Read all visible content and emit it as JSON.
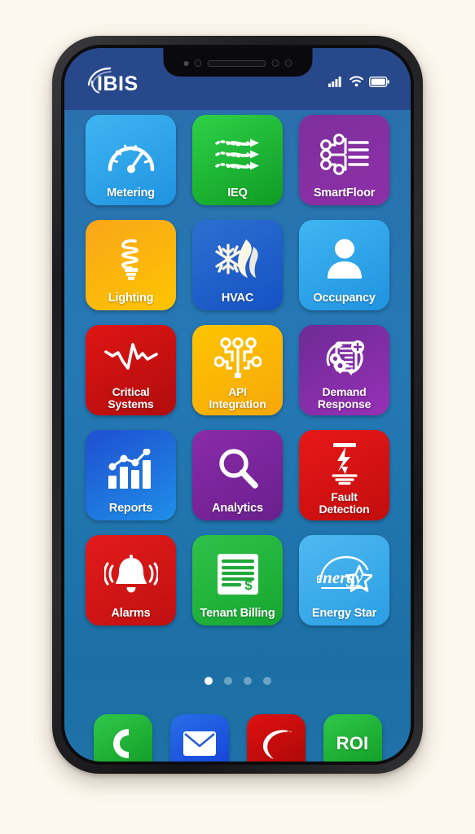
{
  "device": {
    "frame_color": "#1d1d1f",
    "screen_bg_top": "#28488c",
    "screen_bg_main": "#2578b4",
    "page_bg": "#fdf8ef"
  },
  "status_bar": {
    "brand": "IBIS",
    "icons": [
      "signal-bars-icon",
      "wifi-icon",
      "battery-icon"
    ]
  },
  "apps": [
    {
      "id": "metering",
      "label": "Metering",
      "icon": "gauge-icon",
      "color_start": "#3fb5f2",
      "color_end": "#1f93e0"
    },
    {
      "id": "ieq",
      "label": "IEQ",
      "icon": "airflow-icon",
      "color_start": "#2fd14a",
      "color_end": "#0f9c22"
    },
    {
      "id": "smartfloor",
      "label": "SmartFloor",
      "icon": "circuit-floor-icon",
      "color_start": "#7e2f9e",
      "color_end": "#8e2fa8"
    },
    {
      "id": "lighting",
      "label": "Lighting",
      "icon": "cfl-bulb-icon",
      "color_start": "#f9a51a",
      "color_end": "#fdc500"
    },
    {
      "id": "hvac",
      "label": "HVAC",
      "icon": "snowflake-flame-icon",
      "color_start": "#2d6fd0",
      "color_end": "#1552c4"
    },
    {
      "id": "occupancy",
      "label": "Occupancy",
      "icon": "person-icon",
      "color_start": "#3fb5f2",
      "color_end": "#1f93e0"
    },
    {
      "id": "critical-systems",
      "label": "Critical\nSystems",
      "icon": "trend-line-icon",
      "color_start": "#e01414",
      "color_end": "#b00d0d"
    },
    {
      "id": "api-integration",
      "label": "API\nIntegration",
      "icon": "api-nodes-icon",
      "color_start": "#fdc500",
      "color_end": "#f7a70a"
    },
    {
      "id": "demand-response",
      "label": "Demand\nResponse",
      "icon": "doc-gears-cycle-icon",
      "color_start": "#6d2b96",
      "color_end": "#9730b5"
    },
    {
      "id": "reports",
      "label": "Reports",
      "icon": "bar-chart-icon",
      "color_start": "#1f4fd0",
      "color_end": "#1f8fe8"
    },
    {
      "id": "analytics",
      "label": "Analytics",
      "icon": "magnifier-icon",
      "color_start": "#8a2ba8",
      "color_end": "#6a1f8e"
    },
    {
      "id": "fault-detection",
      "label": "Fault\nDetection",
      "icon": "lightning-ground-icon",
      "color_start": "#e81818",
      "color_end": "#c20d0d"
    },
    {
      "id": "alarms",
      "label": "Alarms",
      "icon": "bell-ringing-icon",
      "color_start": "#e31b1b",
      "color_end": "#c01010"
    },
    {
      "id": "tenant-billing",
      "label": "Tenant Billing",
      "icon": "invoice-dollar-icon",
      "color_start": "#2fc24a",
      "color_end": "#16a62f"
    },
    {
      "id": "energy-star",
      "label": "Energy Star",
      "icon": "energy-star-icon",
      "color_start": "#4fb8f0",
      "color_end": "#2a9fe4"
    }
  ],
  "page_dots": {
    "count": 4,
    "active_index": 0
  },
  "dock": [
    {
      "id": "phone",
      "label": "",
      "icon": "phone-icon",
      "color_start": "#2fc94a",
      "color_end": "#119a24"
    },
    {
      "id": "mail",
      "label": "",
      "icon": "envelope-icon",
      "color_start": "#2a6fe8",
      "color_end": "#1340d8"
    },
    {
      "id": "browser",
      "label": "",
      "icon": "ibis-swoosh-icon",
      "color_start": "#e01010",
      "color_end": "#a80808"
    },
    {
      "id": "roi",
      "label": "ROI",
      "icon": "text-icon",
      "color_start": "#2fc94a",
      "color_end": "#119a24"
    }
  ]
}
